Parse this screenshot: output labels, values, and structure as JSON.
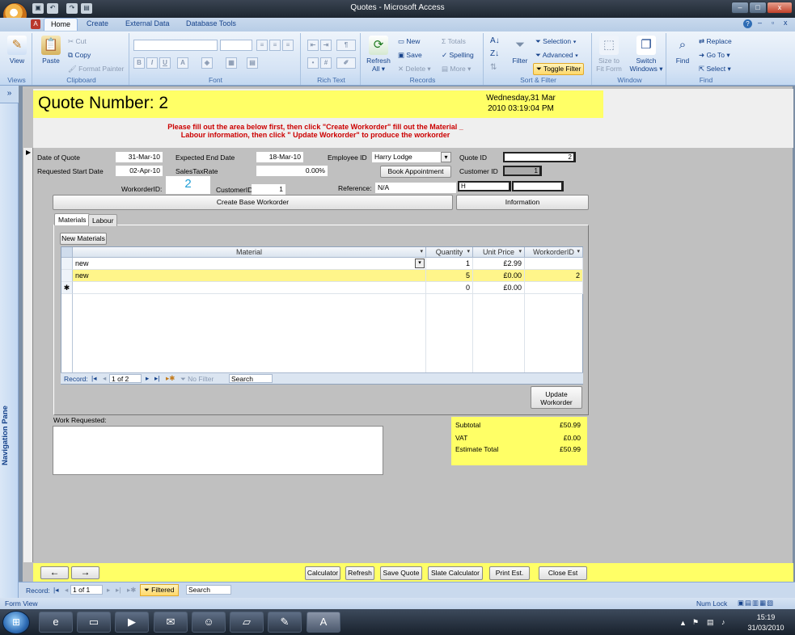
{
  "window": {
    "title": "Quotes - Microsoft Access",
    "min": "–",
    "max": "□",
    "close": "x"
  },
  "ribbon_tabs": [
    "Home",
    "Create",
    "External Data",
    "Database Tools"
  ],
  "ribbon": {
    "views": {
      "view": "View",
      "label": "Views"
    },
    "clipboard": {
      "paste": "Paste",
      "cut": "Cut",
      "copy": "Copy",
      "format_painter": "Format Painter",
      "label": "Clipboard"
    },
    "font": {
      "bold": "B",
      "italic": "I",
      "underline": "U",
      "color": "A",
      "label": "Font"
    },
    "rich_text": {
      "label": "Rich Text"
    },
    "records": {
      "refresh": "Refresh",
      "refresh_all": "All ▾",
      "new": "New",
      "save": "Save",
      "delete": "Delete ▾",
      "totals": "Totals",
      "spelling": "Spelling",
      "more": "More ▾",
      "label": "Records"
    },
    "sort_filter": {
      "filter": "Filter",
      "selection": "Selection ▾",
      "advanced": "Advanced ▾",
      "toggle_filter": "Toggle Filter",
      "label": "Sort & Filter"
    },
    "window": {
      "size_to": "Size to",
      "fit_form": "Fit Form",
      "switch": "Switch",
      "windows": "Windows ▾",
      "label": "Window"
    },
    "find": {
      "find": "Find",
      "replace": "Replace",
      "goto": "Go To ▾",
      "select": "Select ▾",
      "label": "Find"
    }
  },
  "nav_pane": {
    "chevron": "»",
    "label": "Navigation Pane"
  },
  "form": {
    "title": "Quote Number: 2",
    "date_line1": "Wednesday,31 Mar",
    "date_line2": "2010 03:19:04 PM",
    "instr_line1": "Please fill out the area below first, then click \"Create Workorder\" fill out the Material _",
    "instr_line2": "Labour information, then click \" Update Workorder\" to produce the workorder",
    "record_arrow": "▶",
    "fields": {
      "date_of_quote_label": "Date of Quote",
      "date_of_quote": "31-Mar-10",
      "requested_start_label": "Requested Start Date",
      "requested_start": "02-Apr-10",
      "expected_end_label": "Expected End Date",
      "expected_end": "18-Mar-10",
      "sales_tax_label": "SalesTaxRate",
      "sales_tax": "0.00%",
      "employee_id_label": "Employee ID",
      "employee_id": "Harry Lodge",
      "quote_id_label": "Quote ID",
      "quote_id": "2",
      "customer_id_label": "Customer ID",
      "customer_id_box": "1",
      "workorder_id_label": "WorkorderID:",
      "workorder_id": "2",
      "customer_id2_label": "CustomerID",
      "customer_id2": "1",
      "reference_label": "Reference:",
      "reference": "N/A",
      "h_box": "H"
    },
    "buttons": {
      "book_appointment": "Book Appointment",
      "create_base_workorder": "Create Base Workorder",
      "information": "Information",
      "new_materials": "New Materials",
      "update_workorder_1": "Update",
      "update_workorder_2": "Workorder"
    },
    "tabs": [
      "Materials",
      "Labour"
    ],
    "subform": {
      "columns": [
        "Material",
        "Quantity",
        "Unit Price",
        "WorkorderID"
      ],
      "dropdown_glyph": "▾",
      "rows": [
        {
          "material": "new",
          "quantity": "1",
          "unit_price": "£2.99",
          "workorder_id": ""
        },
        {
          "material": "new",
          "quantity": "5",
          "unit_price": "£0.00",
          "workorder_id": "2"
        },
        {
          "material": "",
          "quantity": "0",
          "unit_price": "£0.00",
          "workorder_id": ""
        }
      ],
      "new_row_marker": "✱",
      "nav": {
        "record_label": "Record:",
        "position": "1 of 2",
        "no_filter": "No Filter",
        "search": "Search"
      }
    },
    "totals": {
      "subtotal_label": "Subtotal",
      "subtotal": "£50.99",
      "vat_label": "VAT",
      "vat": "£0.00",
      "estimate_label": "Estimate Total",
      "estimate": "£50.99"
    },
    "work_requested_label": "Work Requested:",
    "footer_buttons": {
      "back": "←",
      "forward": "→",
      "calculator": "Calculator",
      "refresh": "Refresh",
      "save_quote": "Save Quote",
      "slate_calculator": "Slate Calculator",
      "print_est": "Print Est.",
      "close_est": "Close Est"
    }
  },
  "record_nav": {
    "record_label": "Record:",
    "position": "1 of 1",
    "filtered": "Filtered",
    "search": "Search"
  },
  "statusbar": {
    "left": "Form View",
    "num_lock": "Num Lock"
  },
  "taskbar": {
    "time": "15:19",
    "date": "31/03/2010"
  }
}
